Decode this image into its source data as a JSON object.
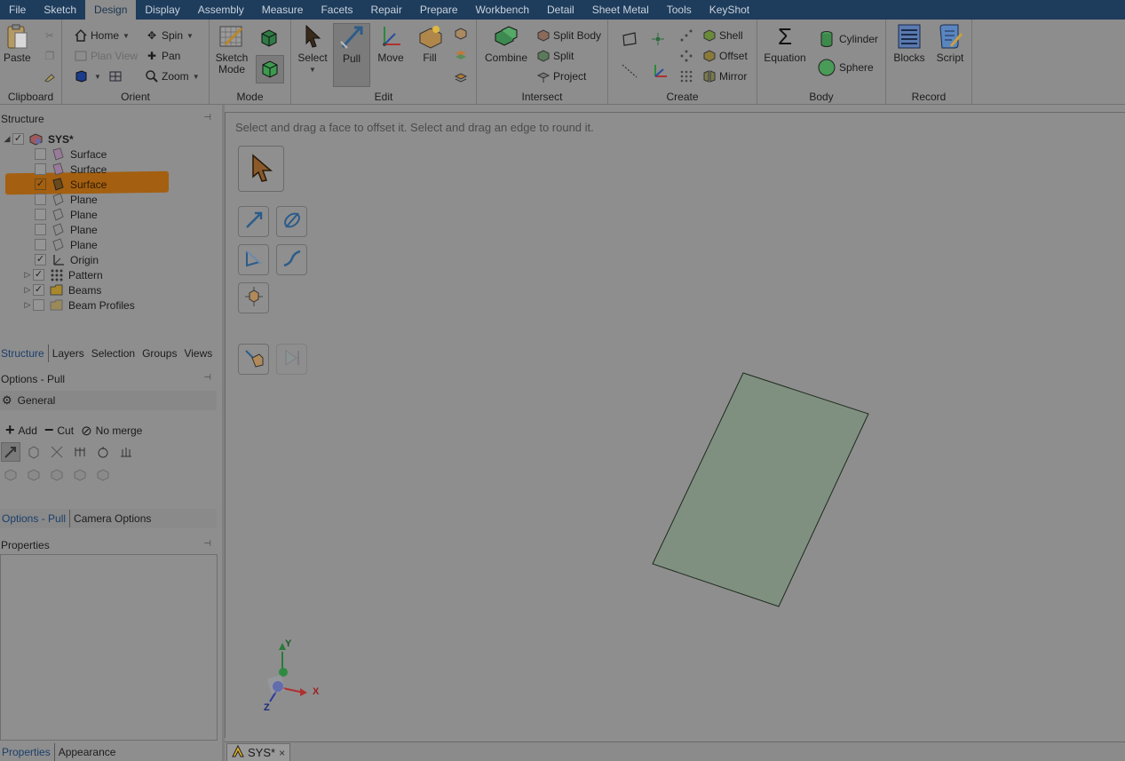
{
  "menu": {
    "items": [
      "File",
      "Sketch",
      "Design",
      "Display",
      "Assembly",
      "Measure",
      "Facets",
      "Repair",
      "Prepare",
      "Workbench",
      "Detail",
      "Sheet Metal",
      "Tools",
      "KeyShot"
    ],
    "active": "Design"
  },
  "ribbon": {
    "clipboard": {
      "label": "Clipboard",
      "paste": "Paste"
    },
    "orient": {
      "label": "Orient",
      "home": "Home",
      "plan_view": "Plan View",
      "spin": "Spin",
      "pan": "Pan",
      "zoom": "Zoom"
    },
    "mode": {
      "label": "Mode",
      "sketch_mode": "Sketch Mode"
    },
    "edit": {
      "label": "Edit",
      "select": "Select",
      "pull": "Pull",
      "move": "Move",
      "fill": "Fill"
    },
    "intersect": {
      "label": "Intersect",
      "combine": "Combine",
      "split_body": "Split Body",
      "split": "Split",
      "project": "Project"
    },
    "create": {
      "label": "Create",
      "shell": "Shell",
      "offset": "Offset",
      "mirror": "Mirror"
    },
    "body": {
      "label": "Body",
      "equation": "Equation",
      "cylinder": "Cylinder",
      "sphere": "Sphere"
    },
    "record": {
      "label": "Record",
      "blocks": "Blocks",
      "script": "Script"
    }
  },
  "structure": {
    "title": "Structure",
    "root": "SYS*",
    "items": [
      {
        "label": "Surface",
        "checked": false
      },
      {
        "label": "Surface",
        "checked": false
      },
      {
        "label": "Surface",
        "checked": true
      },
      {
        "label": "Plane",
        "checked": false
      },
      {
        "label": "Plane",
        "checked": false
      },
      {
        "label": "Plane",
        "checked": false
      },
      {
        "label": "Plane",
        "checked": false
      },
      {
        "label": "Origin",
        "checked": true
      },
      {
        "label": "Pattern",
        "checked": true
      },
      {
        "label": "Beams",
        "checked": true
      },
      {
        "label": "Beam Profiles",
        "checked": false
      }
    ],
    "tabs": [
      "Structure",
      "Layers",
      "Selection",
      "Groups",
      "Views"
    ]
  },
  "options": {
    "title": "Options - Pull",
    "section": "General",
    "add": "Add",
    "cut": "Cut",
    "no_merge": "No merge",
    "tabs": [
      "Options - Pull",
      "Camera Options"
    ]
  },
  "properties": {
    "title": "Properties",
    "tabs": [
      "Properties",
      "Appearance"
    ]
  },
  "viewport": {
    "hint": "Select and drag a face to offset it. Select and drag an edge to round it.",
    "axes": {
      "x": "X",
      "y": "Y",
      "z": "Z"
    },
    "shape_color": "#7f9080"
  },
  "doc_tab": {
    "label": "SYS*",
    "close": "×"
  },
  "colors": {
    "menubar": "#1e3c5c",
    "highlight": "#a45f10",
    "accent_active": "#1b3f6b"
  }
}
